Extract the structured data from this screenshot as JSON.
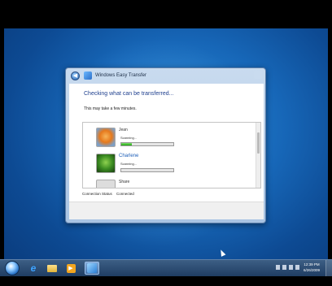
{
  "window": {
    "title": "Windows Easy Transfer",
    "heading": "Checking what can be transferred...",
    "subtext": "This may take a few minutes."
  },
  "users": [
    {
      "name": "Jean",
      "status": "Scanning...",
      "progress": 0.2
    },
    {
      "name": "Charlene",
      "status": "Scanning...",
      "progress": 0.0
    },
    {
      "name": "Share"
    }
  ],
  "connection": {
    "label": "Connection Status",
    "value": "Connected"
  },
  "taskbar": {
    "time": "12:39 PM",
    "date": "6/26/2009"
  },
  "colors": {
    "accent": "#1e5fb8",
    "progress": "#1ea40c"
  }
}
